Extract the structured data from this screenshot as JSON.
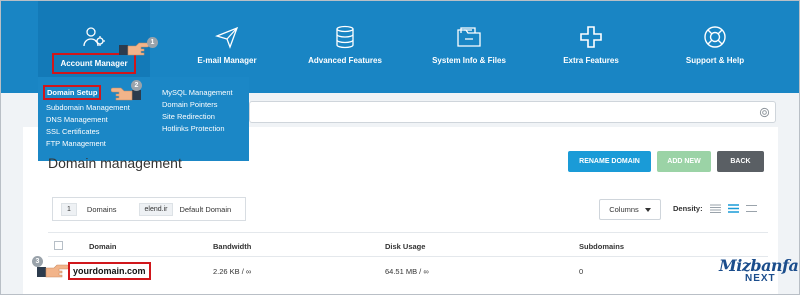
{
  "nav": {
    "items": [
      {
        "label": "Account Manager",
        "icon": "account-manager-icon"
      },
      {
        "label": "E-mail Manager",
        "icon": "paper-plane-icon"
      },
      {
        "label": "Advanced Features",
        "icon": "server-icon"
      },
      {
        "label": "System Info & Files",
        "icon": "folder-icon"
      },
      {
        "label": "Extra Features",
        "icon": "plus-icon"
      },
      {
        "label": "Support & Help",
        "icon": "lifebuoy-icon"
      }
    ]
  },
  "dropdown": {
    "col1": [
      "Domain Setup",
      "Subdomain Management",
      "DNS Management",
      "SSL Certificates",
      "FTP Management"
    ],
    "col2": [
      "MySQL Management",
      "Domain Pointers",
      "Site Redirection",
      "Hotlinks Protection"
    ]
  },
  "page": {
    "title": "Domain management",
    "buttons": {
      "rename": "RENAME DOMAIN",
      "add": "ADD NEW",
      "back": "BACK"
    }
  },
  "summary": {
    "count": "1",
    "count_label": "Domains",
    "default_domain": "elend.ir",
    "default_label": "Default Domain"
  },
  "toolbar": {
    "columns": "Columns",
    "density": "Density:"
  },
  "table": {
    "headers": [
      "Domain",
      "Bandwidth",
      "Disk Usage",
      "Subdomains"
    ],
    "rows": [
      {
        "domain": "yourdomain.com",
        "bandwidth": "2.26 KB / ∞",
        "disk": "64.51 MB / ∞",
        "subdomains": "0"
      }
    ]
  },
  "annotations": {
    "step1": "1",
    "step2": "2",
    "step3": "3"
  },
  "logo": {
    "text": "Mizbanfa",
    "sub": "NEXT"
  },
  "colors": {
    "nav_bg": "#1985c4",
    "rename_btn": "#1a9bd7",
    "add_btn": "#9bd3a6",
    "back_btn": "#5a5f64",
    "highlight": "#d0161b"
  }
}
